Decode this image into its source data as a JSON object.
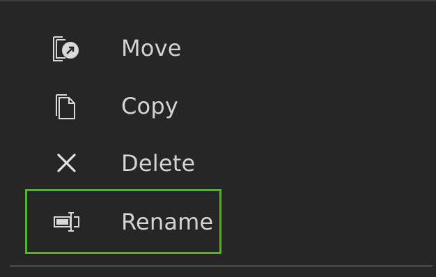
{
  "menu": {
    "items": [
      {
        "id": "move",
        "label": "Move",
        "icon": "move-icon"
      },
      {
        "id": "copy",
        "label": "Copy",
        "icon": "copy-icon"
      },
      {
        "id": "delete",
        "label": "Delete",
        "icon": "close-icon"
      },
      {
        "id": "rename",
        "label": "Rename",
        "icon": "rename-icon",
        "focused": true
      }
    ]
  },
  "colors": {
    "background": "#262626",
    "text": "#d4d4d4",
    "icon": "#d9d9d9",
    "focus_outline": "#4fb821"
  }
}
